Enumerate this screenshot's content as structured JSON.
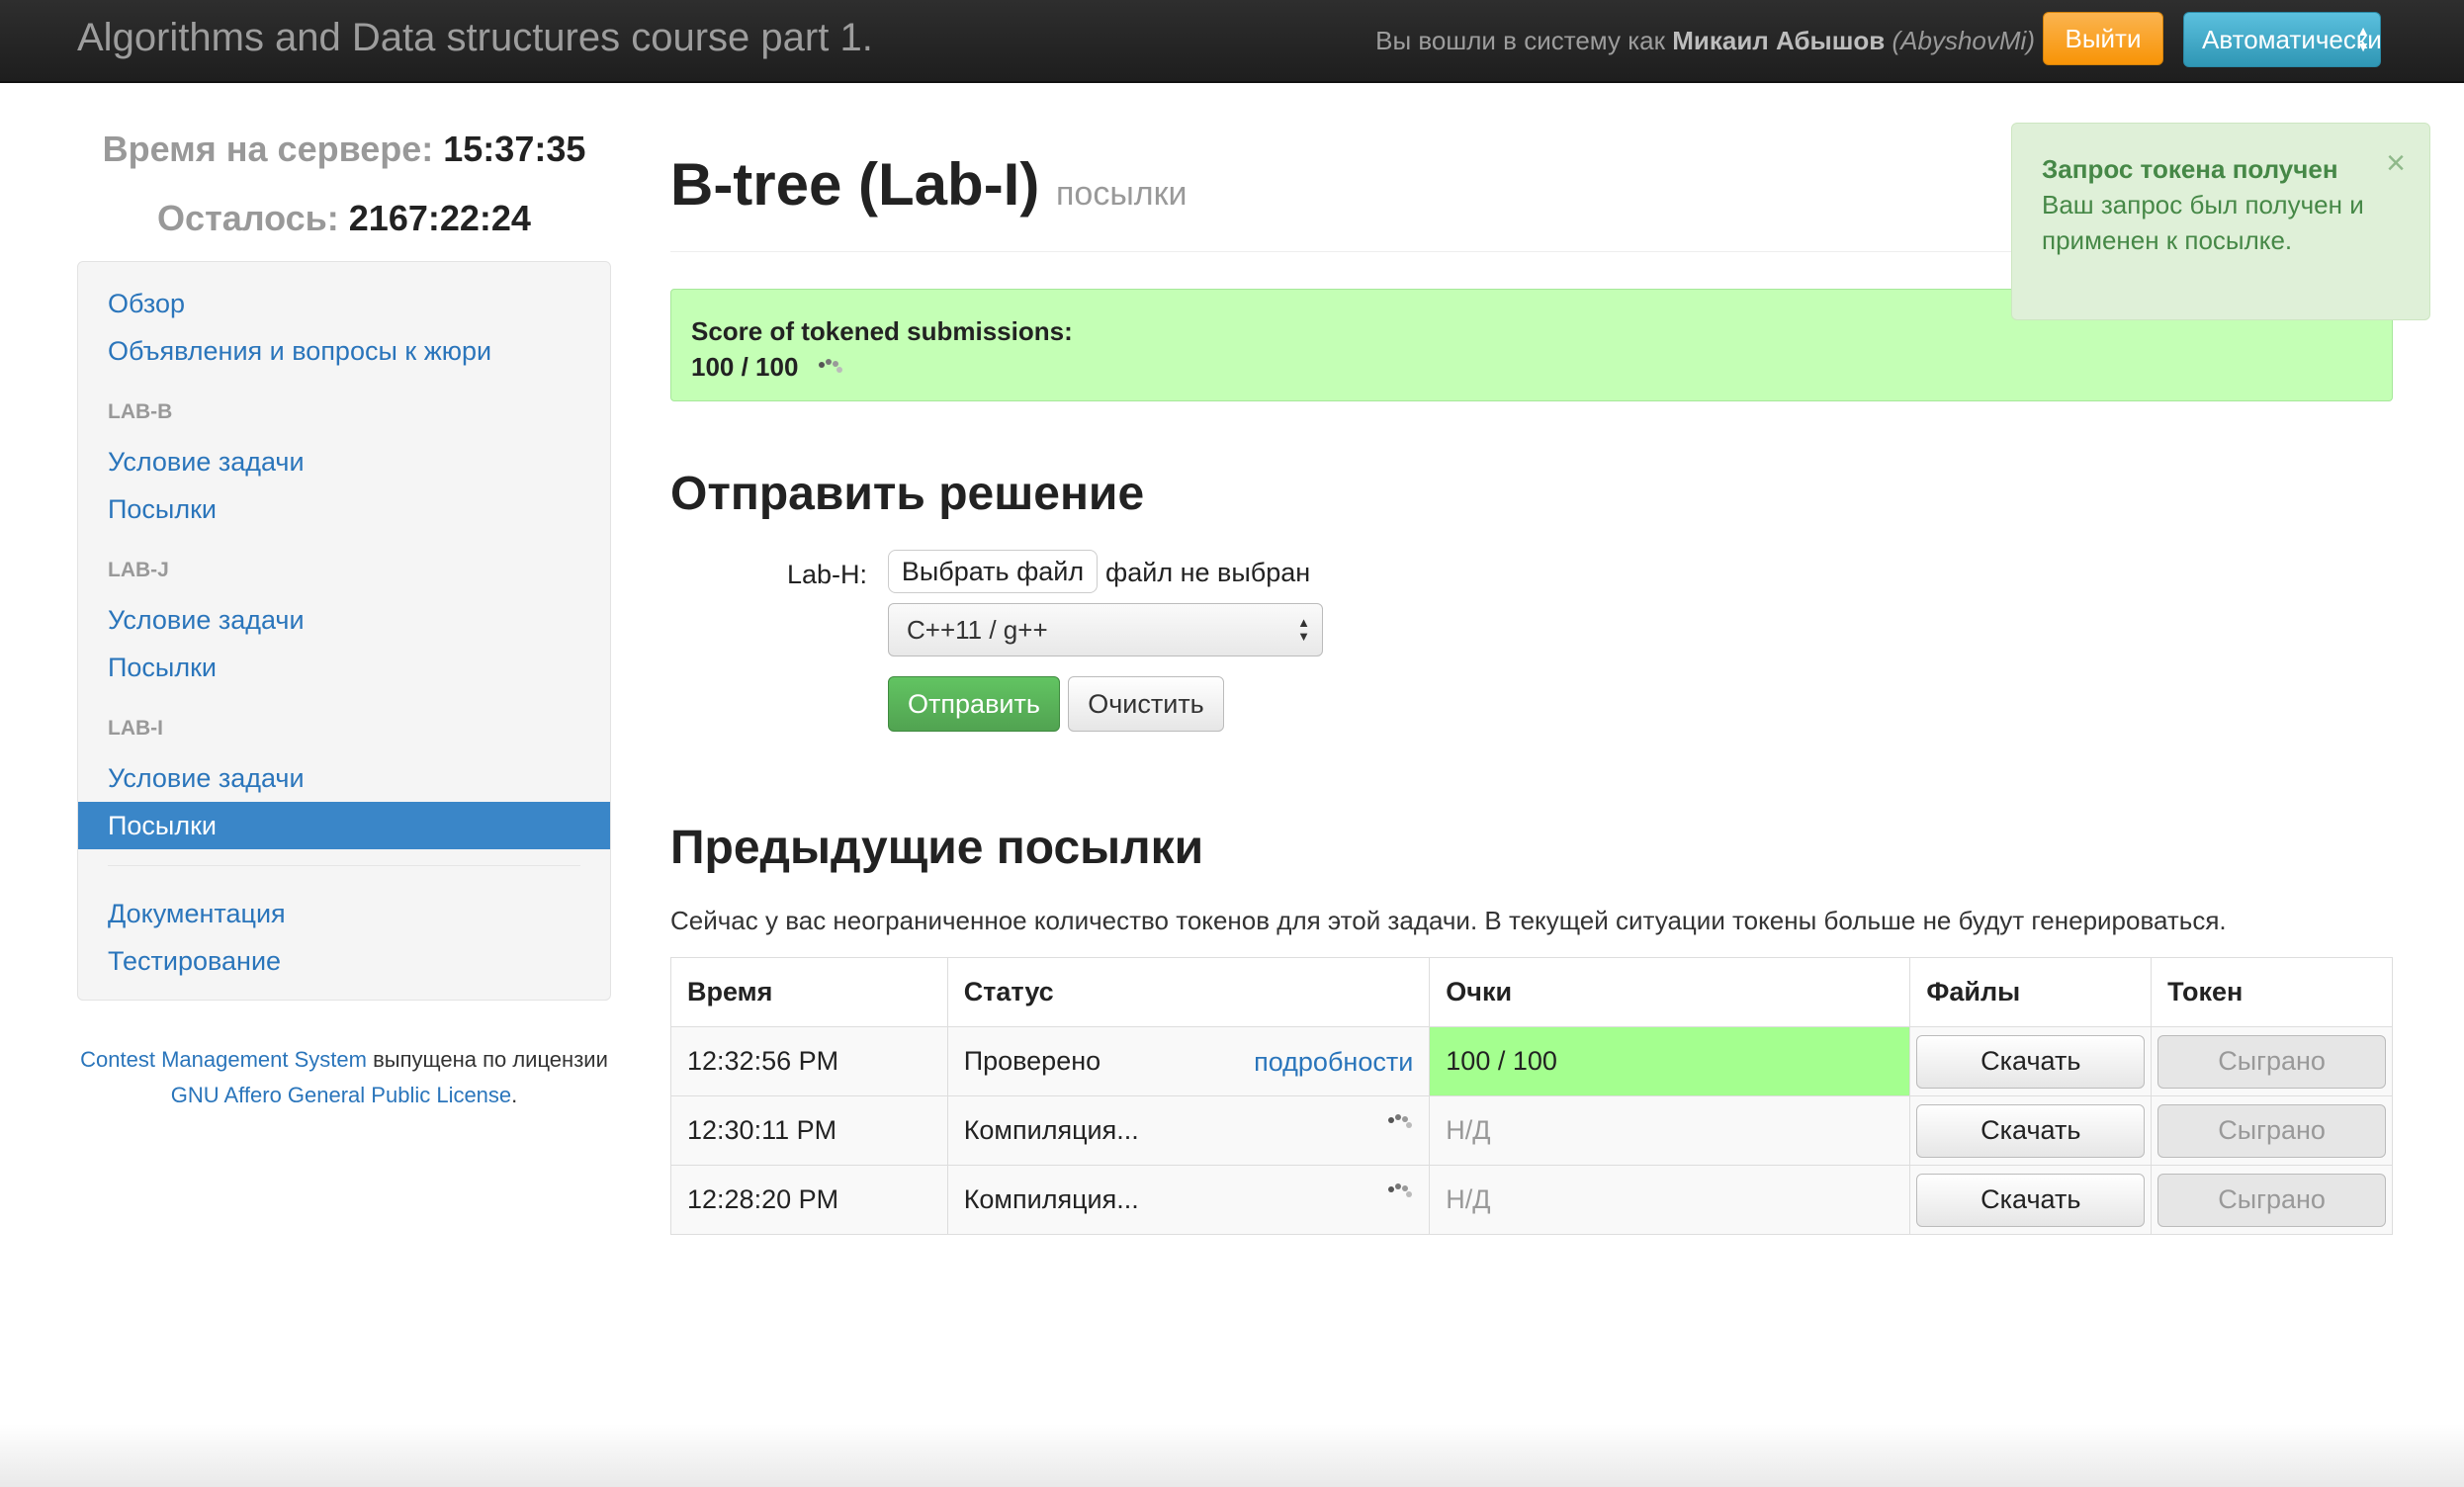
{
  "navbar": {
    "brand": "Algorithms and Data structures course part 1.",
    "login_prefix": "Вы вошли в систему как ",
    "user_name": "Микаил Абышов",
    "user_login": "(AbyshovMi)",
    "logout_label": "Выйти",
    "language_value": "Автоматически"
  },
  "sidebar": {
    "server_time_label": "Время на сервере: ",
    "server_time": "15:37:35",
    "remaining_label": "Осталось: ",
    "remaining": "2167:22:24",
    "overview": "Обзор",
    "announcements": "Объявления и вопросы к жюри",
    "sections": [
      {
        "header": "LAB-B",
        "statement": "Условие задачи",
        "submissions": "Посылки"
      },
      {
        "header": "LAB-J",
        "statement": "Условие задачи",
        "submissions": "Посылки"
      },
      {
        "header": "LAB-I",
        "statement": "Условие задачи",
        "submissions": "Посылки"
      }
    ],
    "documentation": "Документация",
    "testing": "Тестирование",
    "footer": {
      "cms_link": "Contest Management System",
      "text1": " выпущена по лицензии ",
      "license_link": "GNU Affero General Public License",
      "text2": "."
    }
  },
  "main": {
    "title": "B-tree (Lab-I)",
    "subtitle": "посылки",
    "score_label": "Score of tokened submissions:",
    "score_value": "100 / 100",
    "submit_heading": "Отправить решение",
    "file_label": "Lab-H:",
    "choose_file": "Выбрать файл",
    "no_file": "файл не выбран",
    "language_selected": "C++11 / g++",
    "send_label": "Отправить",
    "clear_label": "Очистить",
    "previous_heading": "Предыдущие посылки",
    "tokens_note": "Сейчас у вас неограниченное количество токенов для этой задачи. В текущей ситуации токены больше не будут генерироваться.",
    "table": {
      "headers": [
        "Время",
        "Статус",
        "Очки",
        "Файлы",
        "Токен"
      ],
      "rows": [
        {
          "time": "12:32:56 PM",
          "status": "Проверено",
          "details": "подробности",
          "score": "100 / 100",
          "files": "Скачать",
          "token": "Сыграно"
        },
        {
          "time": "12:30:11 PM",
          "status": "Компиляция...",
          "details": "",
          "score": "Н/Д",
          "files": "Скачать",
          "token": "Сыграно"
        },
        {
          "time": "12:28:20 PM",
          "status": "Компиляция...",
          "details": "",
          "score": "Н/Д",
          "files": "Скачать",
          "token": "Сыграно"
        }
      ]
    }
  },
  "notification": {
    "title": "Запрос токена получен",
    "body": "Ваш запрос был получен и применен к посылке.",
    "close_icon": "×"
  },
  "colors": {
    "score_ok": "#a4ff8f",
    "score_box": "#c4ffb5",
    "link": "#2a75bb",
    "active_nav": "#3a86c8",
    "logout": "#f89406",
    "send": "#51a351",
    "toast_bg": "#dff0d8"
  }
}
